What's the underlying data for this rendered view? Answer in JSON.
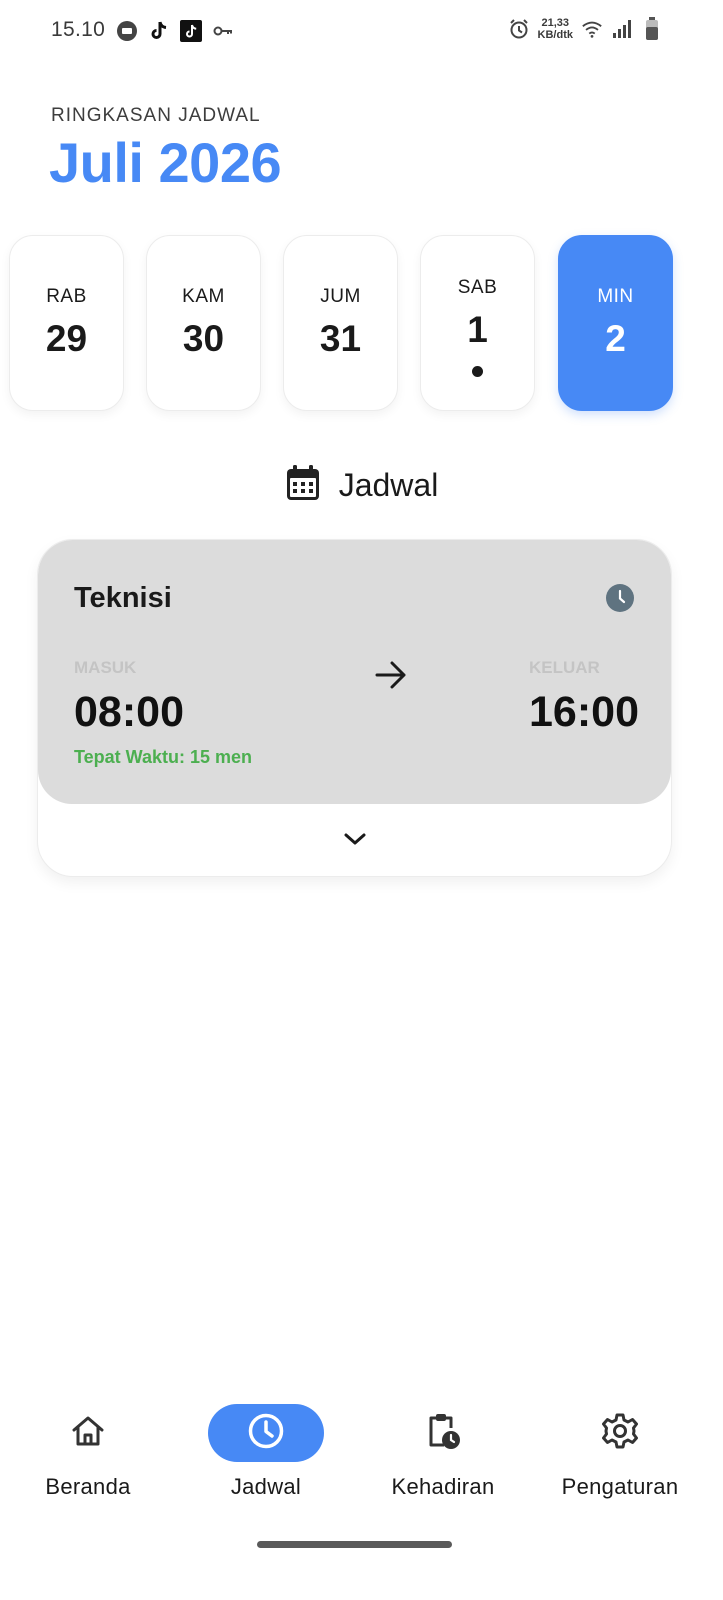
{
  "status_bar": {
    "time": "15.10",
    "net_speed_value": "21,33",
    "net_speed_unit": "KB/dtk"
  },
  "header": {
    "overline": "RINGKASAN JADWAL",
    "month_title": "Juli 2026"
  },
  "days": [
    {
      "dow": "RAB",
      "day": "29",
      "selected": false,
      "has_event": false
    },
    {
      "dow": "KAM",
      "day": "30",
      "selected": false,
      "has_event": false
    },
    {
      "dow": "JUM",
      "day": "31",
      "selected": false,
      "has_event": false
    },
    {
      "dow": "SAB",
      "day": "1",
      "selected": false,
      "has_event": true
    },
    {
      "dow": "MIN",
      "day": "2",
      "selected": true,
      "has_event": false
    }
  ],
  "section": {
    "title": "Jadwal",
    "icon": "calendar-icon"
  },
  "schedule": {
    "role": "Teknisi",
    "in_label": "MASUK",
    "in_time": "08:00",
    "out_label": "KELUAR",
    "out_time": "16:00",
    "status_note": "Tepat Waktu: 15 men",
    "status_color": "#4caf50"
  },
  "nav": {
    "items": [
      {
        "label": "Beranda",
        "icon": "home-icon",
        "active": false
      },
      {
        "label": "Jadwal",
        "icon": "clock-icon",
        "active": true
      },
      {
        "label": "Kehadiran",
        "icon": "attendance-clipboard-icon",
        "active": false
      },
      {
        "label": "Pengaturan",
        "icon": "gear-icon",
        "active": false
      }
    ]
  },
  "colors": {
    "accent": "#4789f5",
    "card_gray": "#dcdcdc",
    "success": "#4caf50"
  }
}
